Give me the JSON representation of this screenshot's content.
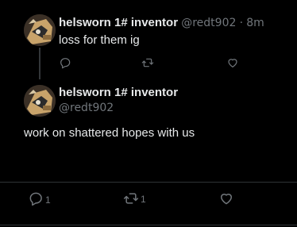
{
  "reply": {
    "display_name": "helsworn 1# inventor",
    "handle": "@redt902",
    "separator": "·",
    "time": "8m",
    "text": "loss for them ig"
  },
  "main_post": {
    "display_name": "helsworn 1# inventor",
    "handle": "@redt902",
    "text": "work on shattered hopes with us",
    "reply_count": "1",
    "repost_count": "1"
  },
  "icons": {
    "reply": "comment-icon",
    "repost": "repost-icon",
    "like": "heart-icon"
  },
  "colors": {
    "background": "#000000",
    "text_primary": "#e7e9ea",
    "text_secondary": "#71767b",
    "divider": "#2f3336"
  }
}
